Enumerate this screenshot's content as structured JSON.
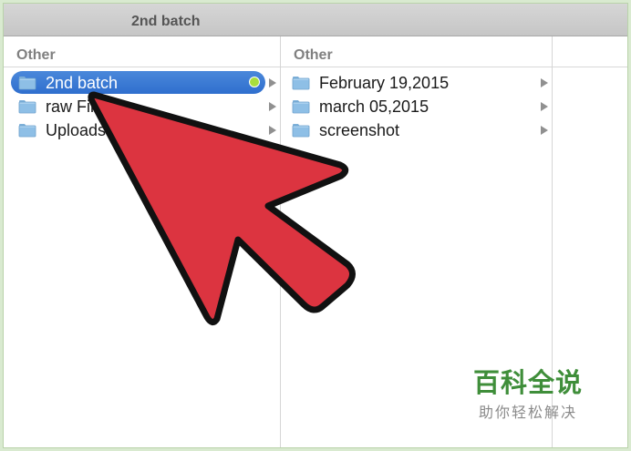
{
  "window": {
    "title": "2nd batch"
  },
  "columns": [
    {
      "header": "Other",
      "items": [
        {
          "label": "2nd batch",
          "selected": true,
          "tagged": true
        },
        {
          "label": "raw Files",
          "selected": false
        },
        {
          "label": "Uploads",
          "selected": false
        }
      ]
    },
    {
      "header": "Other",
      "items": [
        {
          "label": "February 19,2015"
        },
        {
          "label": "march 05,2015"
        },
        {
          "label": "screenshot"
        }
      ]
    }
  ],
  "icons": {
    "folder": "folder-icon",
    "disclosure": "disclosure-triangle-icon",
    "status_tag": "green-tag-dot",
    "pointer": "red-arrow-pointer"
  },
  "colors": {
    "selection": "#3b7bd4",
    "tag_dot": "#a8de3c",
    "arrow_fill": "#dc3440",
    "watermark_green": "#3f8e3a"
  },
  "watermark": {
    "main": "百科全说",
    "sub": "助你轻松解决"
  }
}
